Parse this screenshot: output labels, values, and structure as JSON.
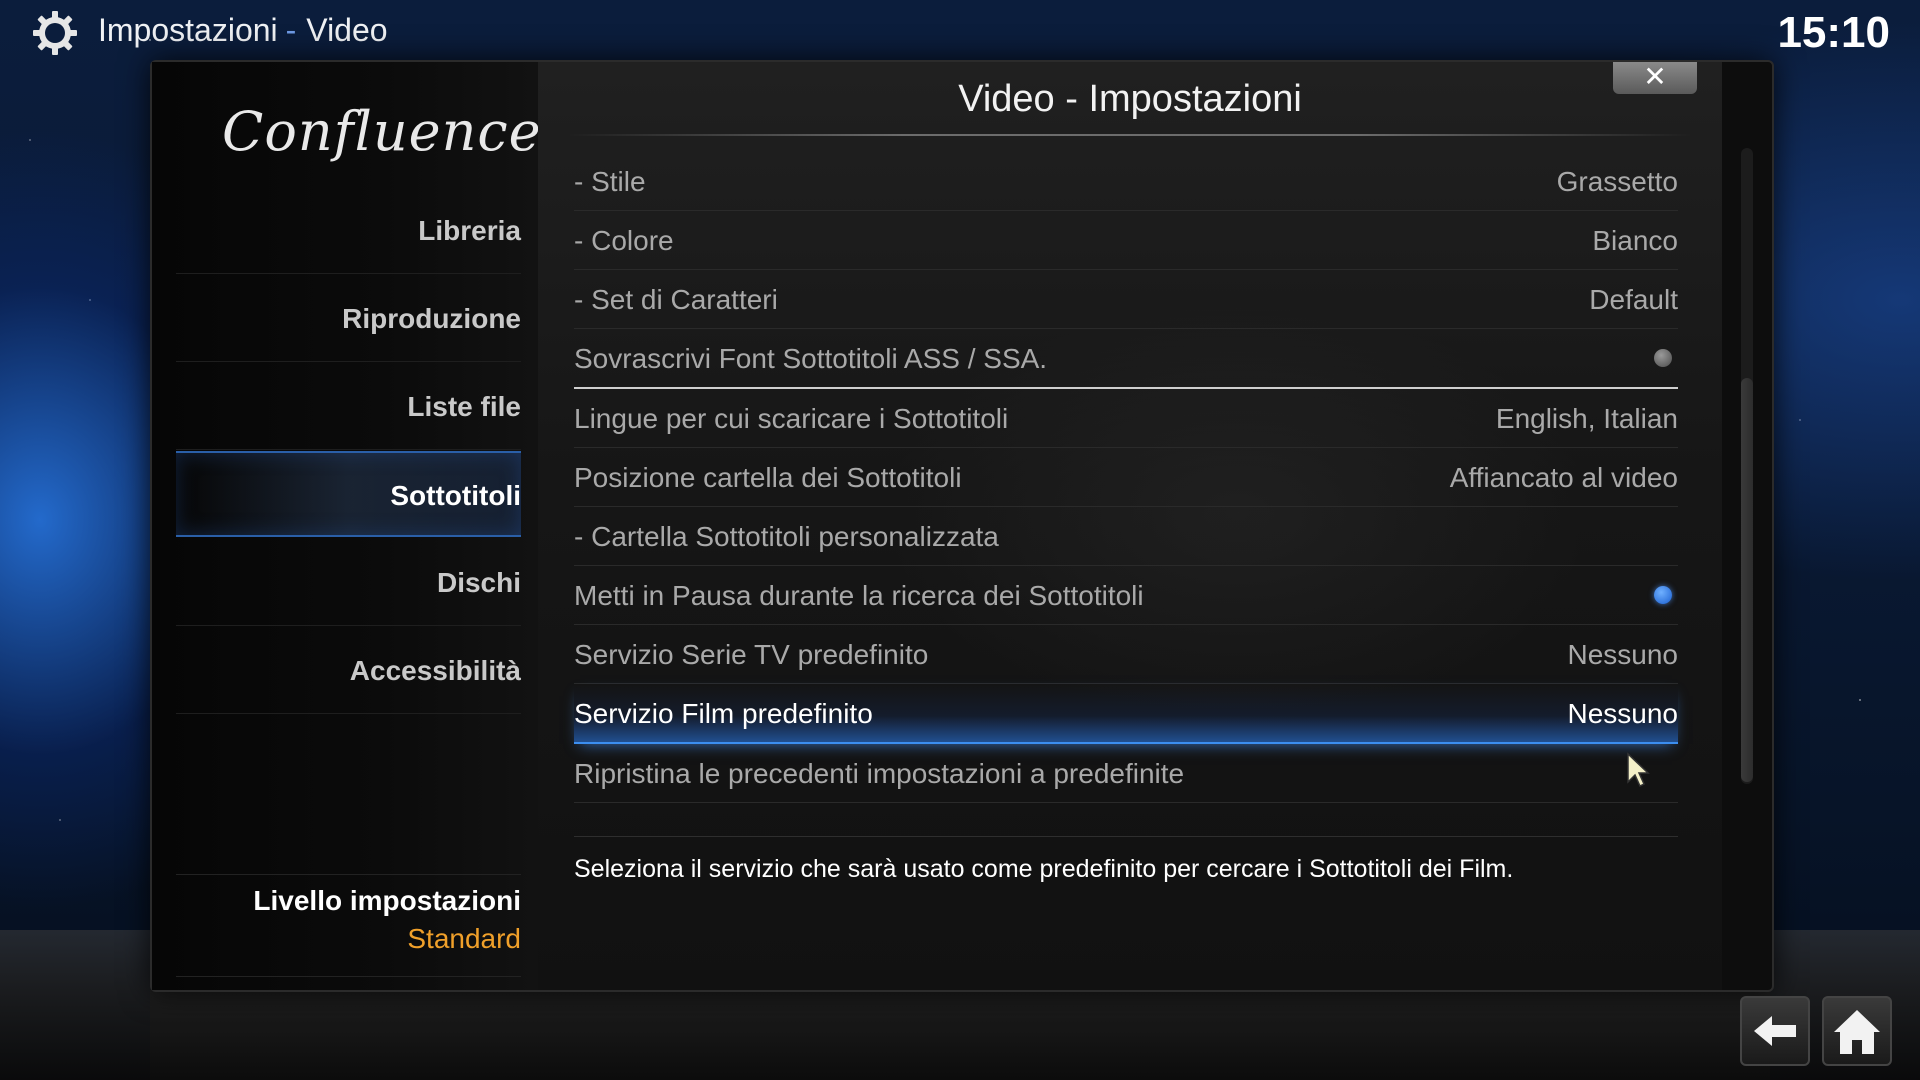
{
  "topbar": {
    "section": "Impostazioni",
    "separator": "-",
    "subsection": "Video",
    "clock": "15:10"
  },
  "logo": {
    "text": "Confluence"
  },
  "sidebar": {
    "items": [
      {
        "label": "Libreria",
        "active": false
      },
      {
        "label": "Riproduzione",
        "active": false
      },
      {
        "label": "Liste file",
        "active": false
      },
      {
        "label": "Sottotitoli",
        "active": true
      },
      {
        "label": "Dischi",
        "active": false
      },
      {
        "label": "Accessibilità",
        "active": false
      }
    ],
    "level": {
      "label": "Livello impostazioni",
      "value": "Standard"
    }
  },
  "dialog": {
    "title": "Video - Impostazioni",
    "close_label": "✕",
    "rows": [
      {
        "label": "- Stile",
        "value": "Grassetto"
      },
      {
        "label": "- Colore",
        "value": "Bianco"
      },
      {
        "label": "- Set di Caratteri",
        "value": "Default"
      },
      {
        "label": "Sovrascrivi Font Sottotitoli ASS / SSA.",
        "toggle": "off"
      },
      {
        "label": "Lingue per cui scaricare i Sottotitoli",
        "value": "English, Italian"
      },
      {
        "label": "Posizione cartella dei Sottotitoli",
        "value": "Affiancato al video"
      },
      {
        "label": "- Cartella Sottotitoli personalizzata",
        "value": ""
      },
      {
        "label": "Metti in Pausa durante la ricerca dei Sottotitoli",
        "toggle": "on"
      },
      {
        "label": "Servizio Serie TV predefinito",
        "value": "Nessuno"
      },
      {
        "label": "Servizio Film predefinito",
        "value": "Nessuno",
        "selected": true
      },
      {
        "label": "Ripristina le precedenti impostazioni a predefinite",
        "value": ""
      }
    ],
    "description": "Seleziona il servizio che sarà usato come predefinito per cercare i Sottotitoli dei Film."
  },
  "icons": {
    "settings": "gear-icon",
    "close": "close-icon",
    "back": "back-arrow-icon",
    "home": "home-icon",
    "cursor": "mouse-pointer-icon"
  },
  "colors": {
    "accent": "#3c8ef0",
    "level_value": "#f0a02a"
  }
}
